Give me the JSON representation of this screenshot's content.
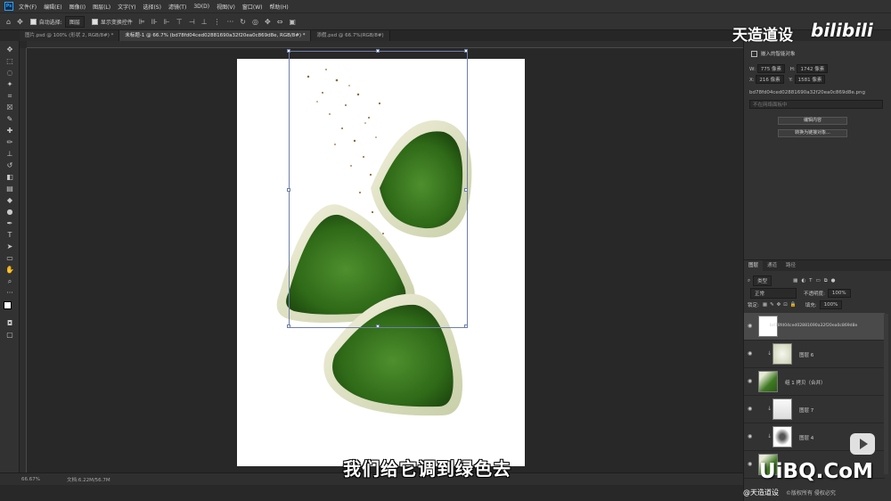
{
  "menu": [
    "文件(F)",
    "编辑(E)",
    "图像(I)",
    "图层(L)",
    "文字(Y)",
    "选择(S)",
    "滤镜(T)",
    "3D(D)",
    "视图(V)",
    "窗口(W)",
    "帮助(H)"
  ],
  "options": {
    "auto_select_label": "自动选择:",
    "auto_select_value": "图层",
    "show_transform_label": "显示变换控件",
    "more": "···"
  },
  "tabs": [
    {
      "label": "图片.psd @ 100% (形状 2, RGB/8#) *",
      "active": false
    },
    {
      "label": "未标题-1 @ 66.7% (bd78fd04ced02881690a32f20ea0c869d8e, RGB/8#) *",
      "active": true
    },
    {
      "label": "添假.psd @ 66.7%(RGB/8#)",
      "active": false
    }
  ],
  "status": {
    "zoom": "66.67%",
    "doc_size": "文档:6.22M/56.7M"
  },
  "properties": {
    "title": "嵌入的智能对象",
    "w_label": "W:",
    "w_value": "775 像素",
    "h_label": "H:",
    "h_value": "1742 像素",
    "x_label": "X:",
    "x_value": "216 像素",
    "y_label": "Y:",
    "y_value": "1581 像素",
    "filename": "bd78fd04ced02881690a32f20ea0c869d8e.png",
    "link_placeholder": "不在网络面板中",
    "edit_button": "编辑内容",
    "convert_button": "转换为链接对象..."
  },
  "layers": {
    "tabs": [
      "图层",
      "通道",
      "路径"
    ],
    "filter_kind": "类型",
    "blend_mode": "正常",
    "opacity_label": "不透明度:",
    "opacity_value": "100%",
    "lock_label": "锁定:",
    "fill_label": "填充:",
    "fill_value": "100%",
    "items": [
      {
        "name": "bd78fd04ced02881690a32f20ea0c869d8e",
        "selected": true
      },
      {
        "name": "图层 6",
        "selected": false
      },
      {
        "name": "组 1 拷贝（合并）",
        "selected": false
      },
      {
        "name": "图层 7",
        "selected": false
      },
      {
        "name": "图层 4",
        "selected": false
      },
      {
        "name": "组 1",
        "selected": false
      }
    ]
  },
  "overlays": {
    "channel_watermark": "天造道设",
    "bili_logo": "bilibili",
    "subtitle": "我们给它调到绿色去",
    "site_watermark": "UiBQ.CoM",
    "credit": "@天造道设",
    "credit_note": "©版权所有 侵权必究"
  },
  "colors": {
    "ps_blue": "#2fa3f7",
    "panel_bg": "#323232",
    "canvas_bg": "#282828",
    "zongzi_green": "#3f7a22"
  }
}
